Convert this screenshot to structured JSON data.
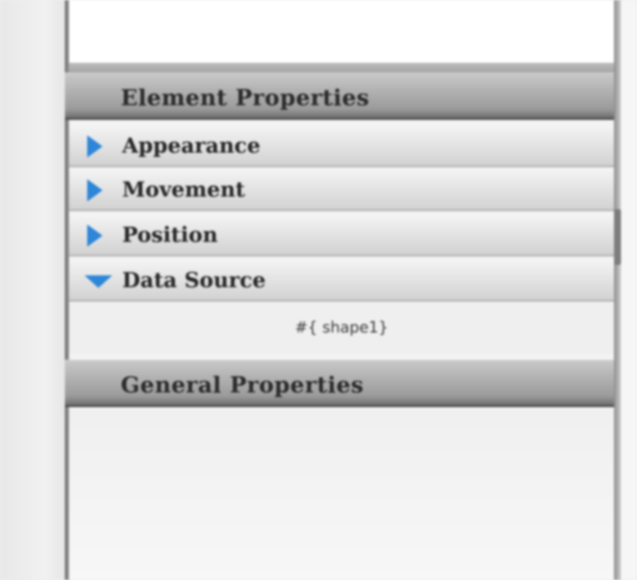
{
  "panel": {
    "element_properties_header": "Element Properties",
    "rows": [
      {
        "label": "Appearance",
        "expanded": false,
        "icon": "disclosure-right-icon"
      },
      {
        "label": "Movement",
        "expanded": false,
        "icon": "disclosure-right-icon"
      },
      {
        "label": "Position",
        "expanded": false,
        "icon": "disclosure-right-icon"
      },
      {
        "label": "Data Source",
        "expanded": true,
        "icon": "disclosure-down-icon"
      }
    ],
    "data_source_value": "#{ shape1}",
    "general_properties_header": "General Properties"
  },
  "colors": {
    "disclosure_arrow": "#2d86d8",
    "header_gradient_dark": "#6f6f6f",
    "header_gradient_light": "#c9c9c9"
  }
}
